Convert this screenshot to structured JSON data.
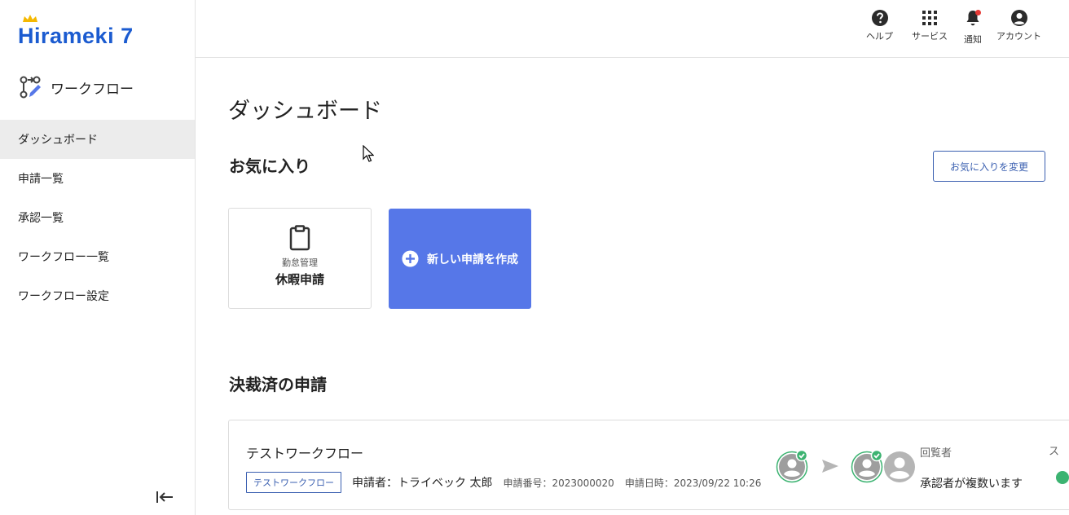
{
  "brand": {
    "logo_text": "Hirameki 7",
    "accent": "#1b5bd0"
  },
  "app": {
    "title": "ワークフロー",
    "icon": "workflow-icon"
  },
  "sidebar": {
    "items": [
      {
        "label": "ダッシュボード",
        "active": true
      },
      {
        "label": "申請一覧",
        "active": false
      },
      {
        "label": "承認一覧",
        "active": false
      },
      {
        "label": "ワークフロー一覧",
        "active": false
      },
      {
        "label": "ワークフロー設定",
        "active": false
      }
    ],
    "collapse_icon": "collapse-left-icon"
  },
  "header": {
    "help": {
      "label": "ヘルプ",
      "icon": "help-icon"
    },
    "services": {
      "label": "サービス",
      "icon": "grid-icon"
    },
    "notifications": {
      "label": "通知",
      "icon": "bell-icon"
    },
    "account": {
      "label": "アカウント",
      "icon": "account-icon"
    }
  },
  "main": {
    "title": "ダッシュボード",
    "favorites": {
      "title": "お気に入り",
      "change_button": "お気に入りを変更",
      "cards": [
        {
          "category": "勤怠管理",
          "name": "休暇申請",
          "icon": "clipboard-icon"
        }
      ],
      "new_request": {
        "label": "新しい申請を作成",
        "icon": "plus-circle-icon",
        "color": "#5677e8"
      }
    },
    "approved": {
      "title": "決裁済の申請",
      "requests": [
        {
          "title": "テストワークフロー",
          "tag": "テストワークフロー",
          "applicant": "申請者：トライベック 太郎",
          "number": "申請番号：2023000020",
          "date": "申請日時：2023/09/22 10:26",
          "reviewer_label": "回覧者",
          "reviewer_value": "承認者が複数います",
          "status_label": "ス"
        }
      ]
    }
  }
}
